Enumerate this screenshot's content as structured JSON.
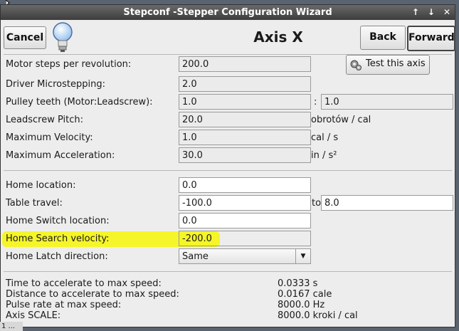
{
  "window": {
    "title": "Stepconf -Stepper Configuration Wizard",
    "title_buttons": [
      "↑",
      "↓",
      "✕"
    ]
  },
  "header": {
    "cancel_label": "Cancel",
    "page_title": "Axis X",
    "back_label": "Back",
    "forward_label": "Forward"
  },
  "test_axis_label": "Test this axis",
  "motor": {
    "steps_label": "Motor steps per revolution:",
    "steps_value": "200.0",
    "microstep_label": "Driver Microstepping:",
    "microstep_value": "2.0",
    "pulley_label": "Pulley teeth (Motor:Leadscrew):",
    "pulley_motor": "1.0",
    "pulley_sep": ":",
    "pulley_leadscrew": "1.0",
    "pitch_label": "Leadscrew Pitch:",
    "pitch_value": "20.0",
    "pitch_unit": "obrotów / cal",
    "vel_label": "Maximum Velocity:",
    "vel_value": "1.0",
    "vel_unit": "cal / s",
    "acc_label": "Maximum Acceleration:",
    "acc_value": "30.0",
    "acc_unit": "in / s²"
  },
  "home": {
    "location_label": "Home location:",
    "location_value": "0.0",
    "travel_label": "Table travel:",
    "travel_from": "-100.0",
    "travel_to_label": "to",
    "travel_to": "8.0",
    "switch_label": "Home Switch location:",
    "switch_value": "0.0",
    "search_label": "Home Search velocity:",
    "search_value": "-200.0",
    "latch_label": "Home Latch direction:",
    "latch_value": "Same"
  },
  "info": {
    "time_label": "Time to accelerate to max speed:",
    "time_value": "0.0333 s",
    "dist_label": "Distance to accelerate to max speed:",
    "dist_value": "0.0167 cale",
    "pulse_label": "Pulse rate at max speed:",
    "pulse_value": "8000.0 Hz",
    "scale_label": "Axis SCALE:",
    "scale_value": "8000.0 kroki / cal"
  },
  "taskbar_text": "1 ...",
  "colors": {
    "highlight": "#f5f52a"
  }
}
